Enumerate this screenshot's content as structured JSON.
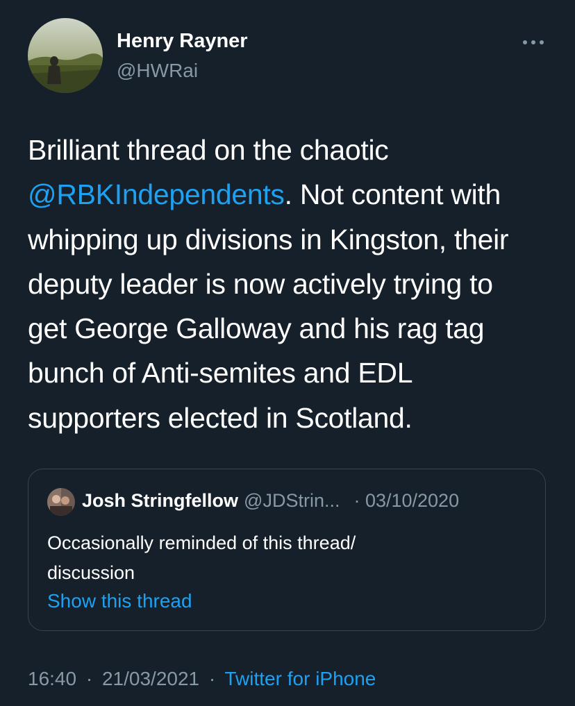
{
  "author": {
    "display_name": "Henry Rayner",
    "handle": "@HWRai"
  },
  "tweet": {
    "line1": "Brilliant thread on the chaotic",
    "mention": "@RBKIndependents",
    "line2_rest": ". Not content with",
    "line3": "whipping up divisions in Kingston, their",
    "line4": "deputy leader is now actively trying to",
    "line5": "get George Galloway and his rag tag",
    "line6": "bunch of Anti-semites and EDL",
    "line7": "supporters elected in Scotland."
  },
  "quoted": {
    "name": "Josh Stringfellow",
    "handle": "@JDStrin...",
    "date": "· 03/10/2020",
    "text_line1": "Occasionally reminded of this thread/",
    "text_line2": "discussion",
    "show_thread": "Show this thread"
  },
  "meta": {
    "time": "16:40",
    "separator": "·",
    "date": "21/03/2021",
    "source": "Twitter for iPhone"
  },
  "colors": {
    "background": "#15202b",
    "accent": "#1da1f2",
    "secondary_text": "#8899a6",
    "border": "#38444d"
  },
  "icons": {
    "more": "more-horizontal-icon"
  }
}
